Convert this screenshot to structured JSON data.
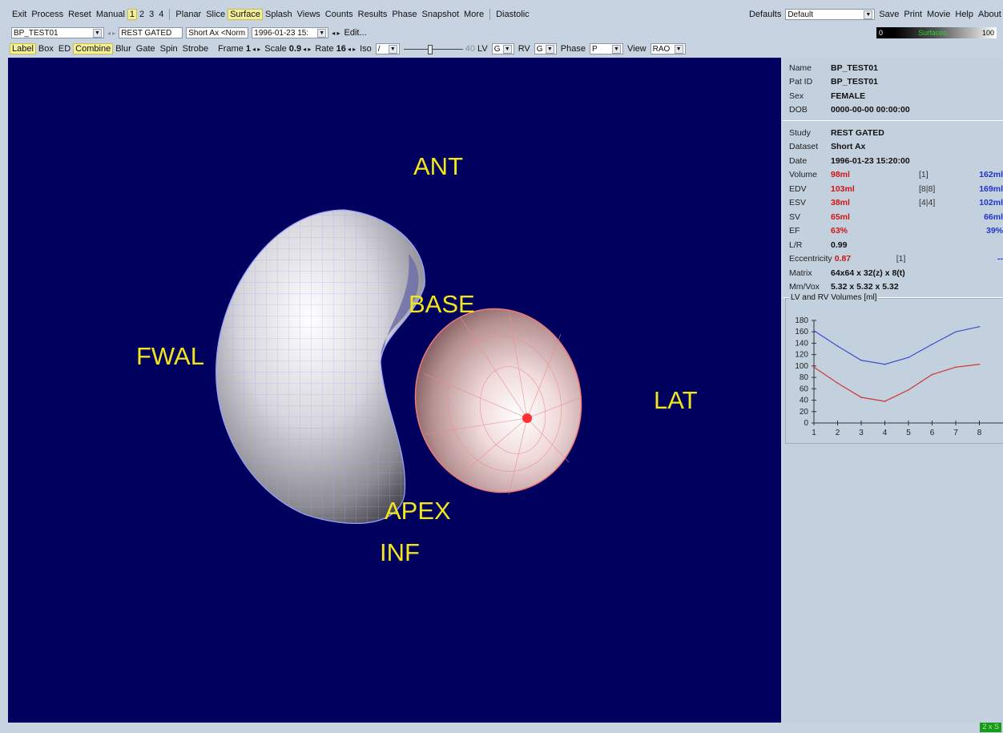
{
  "menubar": {
    "items": [
      "Exit",
      "Process",
      "Reset",
      "Manual",
      "1",
      "2",
      "3",
      "4",
      "Planar",
      "Slice",
      "Surface",
      "Splash",
      "Views",
      "Counts",
      "Results",
      "Phase",
      "Snapshot",
      "More",
      "Diastolic"
    ],
    "defaults_label": "Defaults",
    "defaults_value": "Default",
    "right_items": [
      "Save",
      "Print",
      "Movie",
      "Help",
      "About"
    ]
  },
  "toolbar2": {
    "patient_select": "BP_TEST01",
    "study": "REST GATED",
    "dataset": "Short Ax <Norm",
    "date_select": "1996-01-23 15:",
    "edit": "Edit...",
    "colorbar_min": "0",
    "colorbar_name": "Surfaces",
    "colorbar_max": "100"
  },
  "toolbar3": {
    "toggles": [
      "Label",
      "Box",
      "ED",
      "Combine",
      "Blur",
      "Gate",
      "Spin",
      "Strobe"
    ],
    "frame_label": "Frame",
    "frame_value": "1",
    "scale_label": "Scale",
    "scale_value": "0.9",
    "rate_label": "Rate",
    "rate_value": "16",
    "iso_label": "Iso",
    "iso_value": "/",
    "slider_value": "40",
    "lv_label": "LV",
    "lv_value": "G",
    "rv_label": "RV",
    "rv_value": "G",
    "phase_label": "Phase",
    "phase_value": "P",
    "view_label": "View",
    "view_value": "RAO"
  },
  "viewport": {
    "labels": {
      "ant": "ANT",
      "base": "BASE",
      "fwal": "FWAL",
      "lat": "LAT",
      "apex": "APEX",
      "inf": "INF"
    },
    "label_color": "#f2e51f",
    "background": "#00005e"
  },
  "patient": [
    {
      "k": "Name",
      "v": "BP_TEST01"
    },
    {
      "k": "Pat ID",
      "v": "BP_TEST01"
    },
    {
      "k": "Sex",
      "v": "FEMALE"
    },
    {
      "k": "DOB",
      "v": "0000-00-00 00:00:00"
    }
  ],
  "study": {
    "rows": [
      {
        "k": "Study",
        "v": "REST GATED",
        "mid": "",
        "right": ""
      },
      {
        "k": "Dataset",
        "v": "Short Ax",
        "mid": "",
        "right": ""
      },
      {
        "k": "Date",
        "v": "1996-01-23 15:20:00",
        "mid": "",
        "right": ""
      },
      {
        "k": "Volume",
        "v": "98ml",
        "mid": "[1]",
        "right": "162ml",
        "red": true
      },
      {
        "k": "EDV",
        "v": "103ml",
        "mid": "[8|8]",
        "right": "169ml",
        "red": true
      },
      {
        "k": "ESV",
        "v": "38ml",
        "mid": "[4|4]",
        "right": "102ml",
        "red": true
      },
      {
        "k": "SV",
        "v": "65ml",
        "mid": "",
        "right": "66ml",
        "red": true
      },
      {
        "k": "EF",
        "v": "63%",
        "mid": "",
        "right": "39%",
        "red": true
      },
      {
        "k": "L/R",
        "v": "0.99",
        "mid": "",
        "right": ""
      },
      {
        "k": "Eccentricity",
        "v": "0.87",
        "mid": "[1]",
        "right": "--",
        "red": true
      },
      {
        "k": "Matrix",
        "v": "64x64 x 32(z) x 8(t)",
        "mid": "",
        "right": ""
      },
      {
        "k": "Mm/Vox",
        "v": "5.32 x 5.32 x 5.32",
        "mid": "",
        "right": ""
      }
    ]
  },
  "chart_data": {
    "type": "line",
    "title": "LV and RV Volumes [ml]",
    "x": [
      1,
      2,
      3,
      4,
      5,
      6,
      7,
      8
    ],
    "xticks": [
      "1",
      "2",
      "3",
      "4",
      "5",
      "6",
      "7",
      "8"
    ],
    "ylim": [
      0,
      180
    ],
    "yticks": [
      "0",
      "20",
      "40",
      "60",
      "80",
      "100",
      "120",
      "140",
      "160",
      "180"
    ],
    "series": [
      {
        "color": "#3a4fd0",
        "values": [
          162,
          135,
          110,
          103,
          115,
          138,
          160,
          169
        ]
      },
      {
        "color": "#d03535",
        "values": [
          98,
          70,
          45,
          38,
          58,
          85,
          98,
          103
        ]
      }
    ]
  },
  "status": {
    "badge": "2 x S"
  }
}
